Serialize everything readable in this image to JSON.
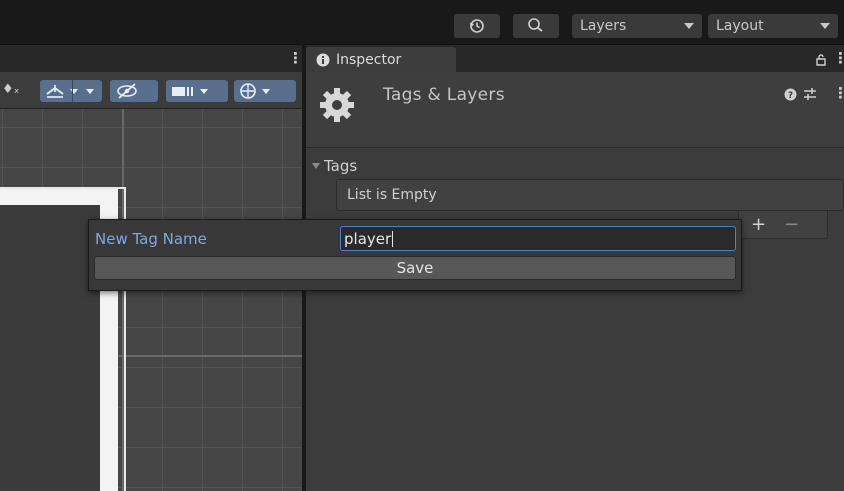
{
  "toolbar": {
    "history_icon": "history-icon",
    "search_icon": "search-icon",
    "layers_label": "Layers",
    "layout_label": "Layout"
  },
  "scene": {
    "toolbar_icons": [
      "fx-icon",
      "gizmo-move-icon",
      "visibility-off-icon",
      "camera-icon",
      "orientation-gizmo-icon"
    ]
  },
  "inspector": {
    "tab_label": "Inspector",
    "title": "Tags & Layers",
    "tags_section_label": "Tags",
    "tags_empty_text": "List is Empty",
    "add_symbol": "+",
    "remove_symbol": "−"
  },
  "popup": {
    "label": "New Tag Name",
    "input_value": "player",
    "save_label": "Save"
  },
  "colors": {
    "accent_blue": "#4a84c8",
    "label_blue": "#7fa8e0",
    "scene_button": "#58708e"
  }
}
